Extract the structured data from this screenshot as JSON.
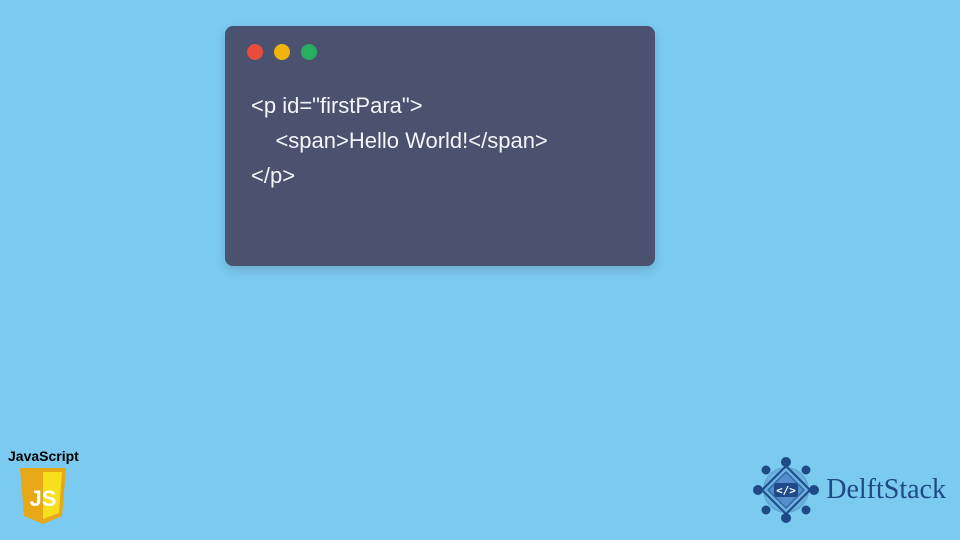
{
  "window": {
    "controls": {
      "red": "close-icon",
      "yellow": "minimize-icon",
      "green": "maximize-icon"
    }
  },
  "code": {
    "line1": "<p id=\"firstPara\">",
    "line2": "    <span>Hello World!</span>",
    "line3": "</p>"
  },
  "jsBadge": {
    "label": "JavaScript",
    "letters": "JS"
  },
  "delft": {
    "brand": "DelftStack",
    "tag": "</>"
  },
  "colors": {
    "bg": "#7bcaf0",
    "window": "#4a5270",
    "code_text": "#f3f5f8",
    "red": "#e74c3c",
    "yellow": "#f1b40f",
    "green": "#27ae60",
    "js_yellow": "#f7df1e",
    "delft_blue": "#1e4a87"
  }
}
